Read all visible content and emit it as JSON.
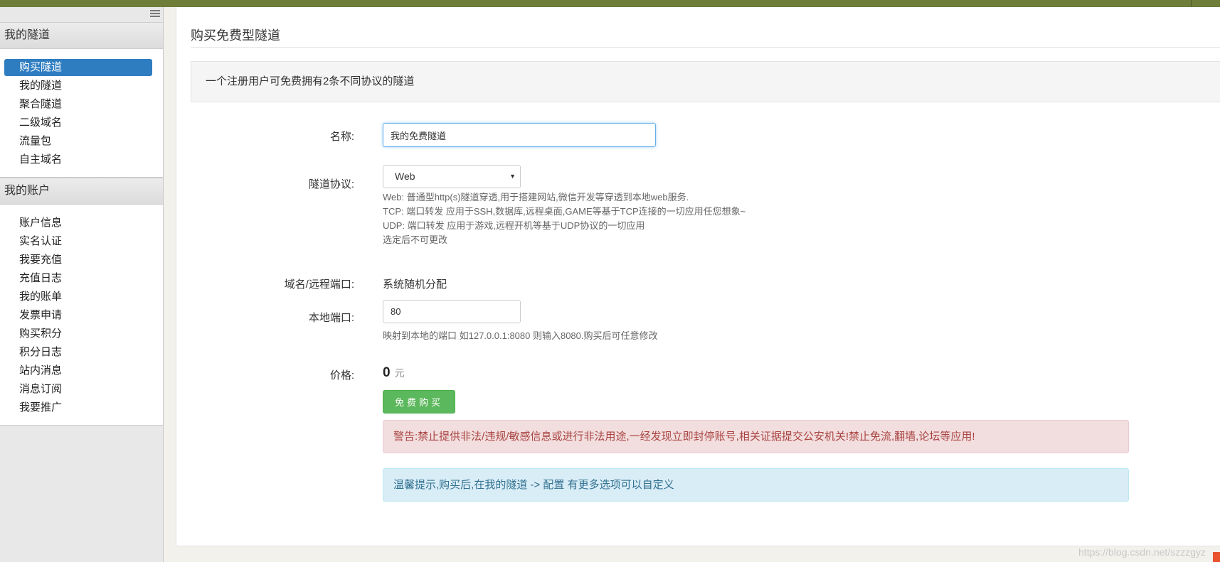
{
  "sidebar": {
    "sections": [
      {
        "title": "我的隧道",
        "items": [
          {
            "label": "购买隧道",
            "active": true
          },
          {
            "label": "我的隧道"
          },
          {
            "label": "聚合隧道"
          },
          {
            "label": "二级域名"
          },
          {
            "label": "流量包"
          },
          {
            "label": "自主域名"
          }
        ]
      },
      {
        "title": "我的账户",
        "items": [
          {
            "label": "账户信息"
          },
          {
            "label": "实名认证"
          },
          {
            "label": "我要充值"
          },
          {
            "label": "充值日志"
          },
          {
            "label": "我的账单"
          },
          {
            "label": "发票申请"
          },
          {
            "label": "购买积分"
          },
          {
            "label": "积分日志"
          },
          {
            "label": "站内消息"
          },
          {
            "label": "消息订阅"
          },
          {
            "label": "我要推广"
          }
        ]
      }
    ]
  },
  "main": {
    "title": "购买免费型隧道",
    "notice": "一个注册用户可免费拥有2条不同协议的隧道",
    "form": {
      "name": {
        "label": "名称:",
        "value": "我的免费隧道"
      },
      "protocol": {
        "label": "隧道协议:",
        "selected": "Web",
        "help": [
          "Web: 普通型http(s)隧道穿透,用于搭建网站,微信开发等穿透到本地web服务.",
          "TCP: 端口转发 应用于SSH,数据库,远程桌面,GAME等基于TCP连接的一切应用任您想象~",
          "UDP: 端口转发 应用于游戏,远程开机等基于UDP协议的一切应用",
          "选定后不可更改"
        ]
      },
      "domain": {
        "label": "域名/远程端口:",
        "value": "系统随机分配"
      },
      "local_port": {
        "label": "本地端口:",
        "value": "80",
        "help": "映射到本地的端口 如127.0.0.1:8080 则输入8080.购买后可任意修改"
      },
      "price": {
        "label": "价格:",
        "value": "0",
        "unit": "元"
      },
      "buy_button": "免费购买"
    },
    "warning": "警告:禁止提供非法/违规/敏感信息或进行非法用途,一经发现立即封停账号,相关证据提交公安机关!禁止免流,翻墙,论坛等应用!",
    "tip": "温馨提示,购买后,在我的隧道 -> 配置 有更多选项可以自定义"
  },
  "watermark": "https://blog.csdn.net/szzzgyz"
}
